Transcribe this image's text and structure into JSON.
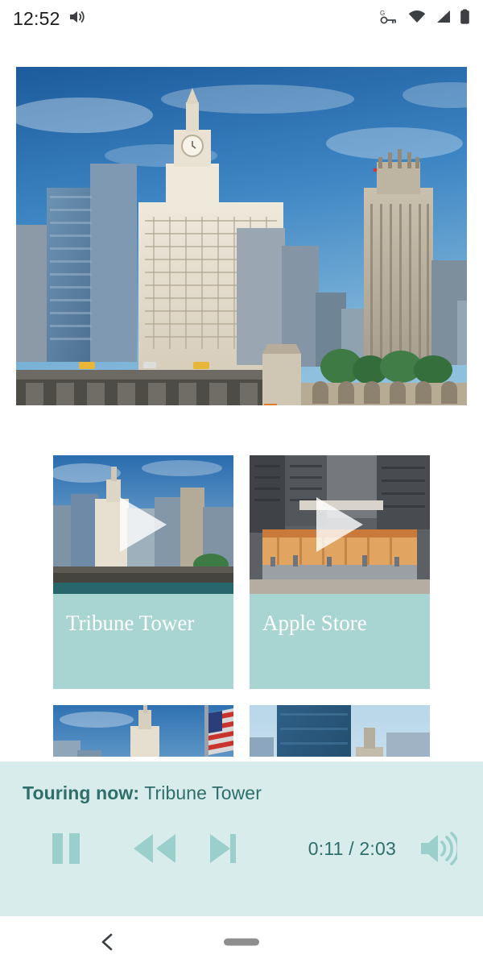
{
  "status_bar": {
    "time": "12:52",
    "left_icons": [
      "volume-icon"
    ],
    "right_icons": [
      "vpn-key-g-icon",
      "wifi-icon",
      "cellular-signal-icon",
      "battery-icon"
    ]
  },
  "hero": {
    "name": "chicago-riverfront-hero-image",
    "alt": "Chicago river skyline with Wrigley Building and Tribune Tower"
  },
  "cards": [
    {
      "title": "Tribune Tower",
      "thumb": "tribune-tower-thumbnail",
      "play": "play-icon"
    },
    {
      "title": "Apple Store",
      "thumb": "apple-store-thumbnail",
      "play": "play-icon"
    },
    {
      "title": "",
      "thumb": "flag-skyline-thumbnail",
      "play": ""
    },
    {
      "title": "",
      "thumb": "glass-tower-thumbnail",
      "play": ""
    }
  ],
  "player": {
    "label": "Touring now:",
    "track_title": "Tribune Tower",
    "pause_label": "pause-button",
    "rewind_label": "rewind-button",
    "forward_label": "forward-button",
    "elapsed": "0:11",
    "separator": "/",
    "duration": "2:03",
    "time_display": "0:11 / 2:03",
    "volume_label": "volume-button"
  },
  "nav_bar": {
    "back": "back-chevron-icon",
    "home": "home-pill-handle"
  },
  "colors": {
    "teal_card": "#a8d5d2",
    "teal_panel": "#d7eceb",
    "teal_text": "#2e6e6b",
    "white": "#ffffff"
  }
}
